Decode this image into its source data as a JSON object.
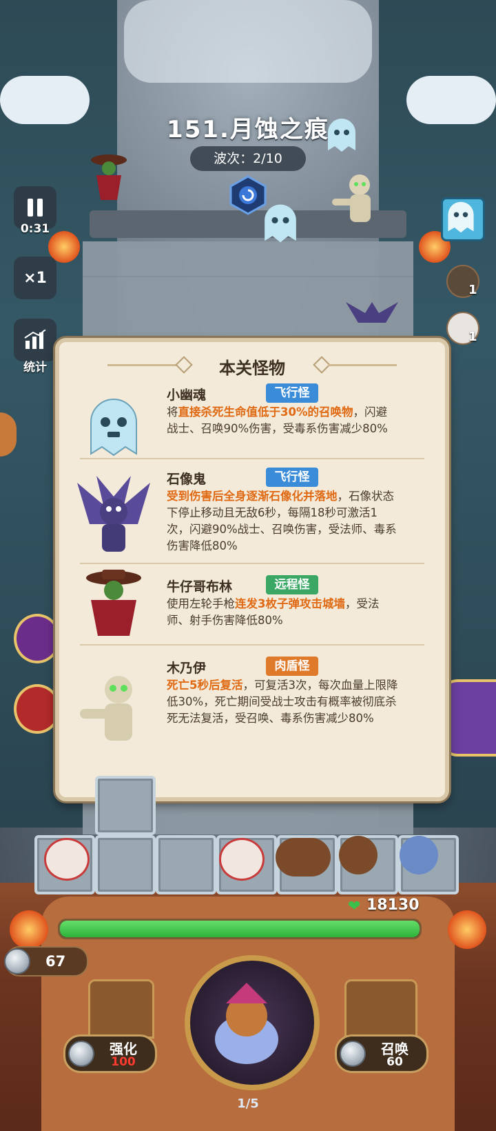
{
  "level": {
    "title": "151.月蚀之痕",
    "wave": "波次：2/10"
  },
  "side": {
    "timer": "0:31",
    "speed": "×1",
    "stats_label": "统计"
  },
  "right_heroes": [
    {
      "count": "1"
    },
    {
      "count": "1"
    }
  ],
  "panel": {
    "title": "本关怪物",
    "monsters": [
      {
        "name": "小幽魂",
        "tag": "飞行怪",
        "tag_type": "fly",
        "desc_prefix": "将",
        "desc_hl": "直接杀死生命值低于30%的召唤物",
        "desc_rest": "，闪避战士、召唤90%伤害，受毒系伤害减少80%",
        "icon": "ghost-icon"
      },
      {
        "name": "石像鬼",
        "tag": "飞行怪",
        "tag_type": "fly",
        "desc_prefix": "",
        "desc_hl": "受到伤害后全身逐渐石像化并落地",
        "desc_rest": "，石像状态下停止移动且无敌6秒，每隔18秒可激活1次，闪避90%战士、召唤伤害，受法师、毒系伤害降低80%",
        "icon": "gargoyle-icon"
      },
      {
        "name": "牛仔哥布林",
        "tag": "远程怪",
        "tag_type": "range",
        "desc_prefix": "使用左轮手枪",
        "desc_hl": "连发3枚子弹攻击城墙",
        "desc_rest": "，受法师、射手伤害降低80%",
        "icon": "cowboy-goblin-icon"
      },
      {
        "name": "木乃伊",
        "tag": "肉盾怪",
        "tag_type": "tank",
        "desc_prefix": "",
        "desc_hl": "死亡5秒后复活",
        "desc_rest": "，可复活3次，每次血量上限降低30%，死亡期间受战士攻击有概率被彻底杀死无法复活，受召唤、毒系伤害减少80%",
        "icon": "mummy-icon"
      }
    ]
  },
  "status": {
    "hp": "18130",
    "hp_fraction": 1.0,
    "coins": "67",
    "progress": "1/5"
  },
  "actions": {
    "upgrade": {
      "label": "强化",
      "cost": "100"
    },
    "summon": {
      "label": "召唤",
      "cost": "60"
    }
  },
  "colors": {
    "highlight": "#e06a14",
    "fly_tag": "#3a8bd8",
    "range_tag": "#3aa864",
    "tank_tag": "#e07a2b",
    "hp": "#2fb23a",
    "cost_red": "#ff3b2f"
  }
}
